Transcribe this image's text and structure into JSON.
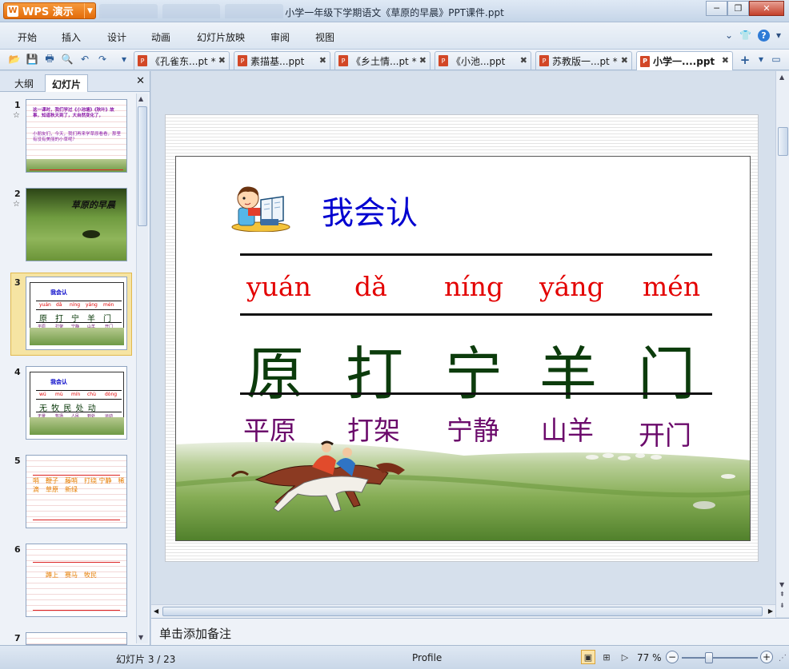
{
  "app": {
    "name": "WPS 演示",
    "window_title": "小学一年级下学期语文《草原的早晨》PPT课件.ppt"
  },
  "menu": [
    "开始",
    "插入",
    "设计",
    "动画",
    "幻灯片放映",
    "审阅",
    "视图"
  ],
  "doc_tabs": [
    {
      "label": "《孔雀东...pt *",
      "active": false
    },
    {
      "label": "素描基...ppt",
      "active": false
    },
    {
      "label": "《乡土情...pt *",
      "active": false
    },
    {
      "label": "《小池...ppt",
      "active": false
    },
    {
      "label": "苏教版一...pt *",
      "active": false
    },
    {
      "label": "小学一....ppt",
      "active": true
    }
  ],
  "left_panel": {
    "tabs": [
      "大纲",
      "幻灯片"
    ],
    "active_tab": "幻灯片",
    "slides": [
      {
        "num": "1",
        "star": "☆"
      },
      {
        "num": "2",
        "star": "☆",
        "title": "草原的早晨"
      },
      {
        "num": "3",
        "selected": true
      },
      {
        "num": "4"
      },
      {
        "num": "5"
      },
      {
        "num": "6"
      },
      {
        "num": "7"
      }
    ]
  },
  "slide": {
    "title": "我会认",
    "pinyin": [
      "yuán",
      "dǎ",
      "níng",
      "yáng",
      "mén"
    ],
    "chars": [
      "原",
      "打",
      "宁",
      "羊",
      "门"
    ],
    "words": [
      "平原",
      "打架",
      "宁静",
      "山羊",
      "开门"
    ]
  },
  "thumbs": {
    "s1_lines": [
      "这一课时，我们学过《小池塘》《秋叶》故事，知道秋天到了，大自然变化了，",
      "小朋友们，今天，我们再来学草原看看，那里有没有美丽的小草呢？"
    ],
    "s4_title": "我会认",
    "s4_pinyin": [
      "wú",
      "mù",
      "mín",
      "chù",
      "dòng"
    ],
    "s4_chars": "无 牧 民 处 动",
    "s4_words": [
      "无景",
      "牧场",
      "人民",
      "到处",
      "运动"
    ],
    "s5_text": "哨　鞭子　藤哨　打绕 宁静　稀滴　草原　新绿",
    "s6_text": "蹲上　赛马　牧民"
  },
  "notes_placeholder": "单击添加备注",
  "status": {
    "slide_indicator": "幻灯片 3 / 23",
    "theme": "Profile",
    "zoom": "77 %",
    "zoom_level_pct": 77
  }
}
